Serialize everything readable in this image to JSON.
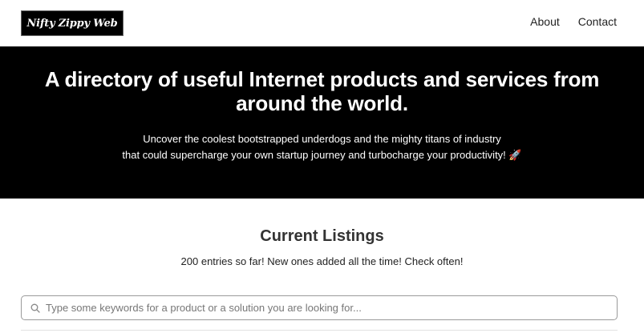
{
  "header": {
    "logo_text": "Nifty Zippy Web",
    "nav": [
      {
        "label": "About"
      },
      {
        "label": "Contact"
      }
    ]
  },
  "hero": {
    "title": "A directory of useful Internet products and services from around the world.",
    "subtitle_line1": "Uncover the coolest bootstrapped underdogs and the mighty titans of industry",
    "subtitle_line2": "that could supercharge your own startup journey and turbocharge your productivity! 🚀"
  },
  "listings": {
    "heading": "Current Listings",
    "count_text": "200 entries so far! New ones added all the time! Check often!"
  },
  "search": {
    "placeholder": "Type some keywords for a product or a solution you are looking for...",
    "value": "",
    "icon": "search-icon"
  },
  "colors": {
    "hero_bg": "#000000",
    "page_bg": "#ffffff",
    "input_border": "#9a9a9a"
  }
}
